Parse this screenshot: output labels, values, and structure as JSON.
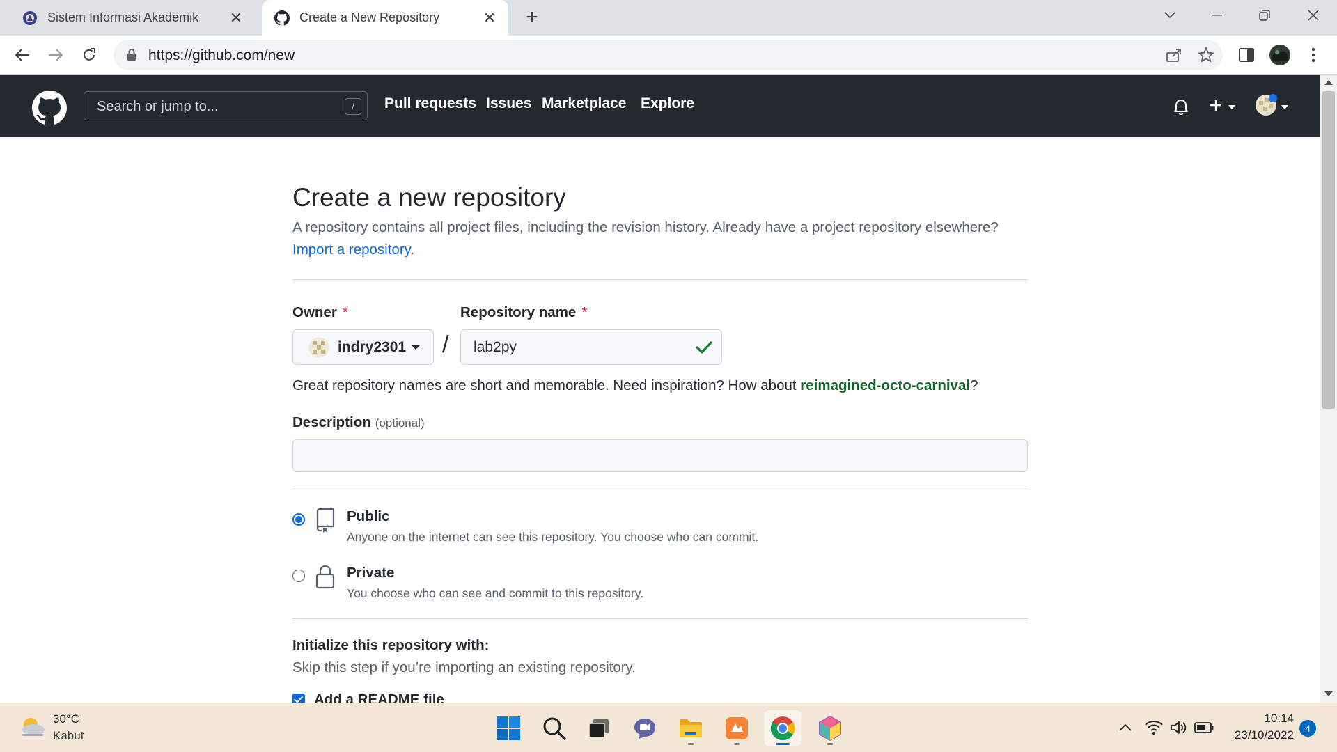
{
  "browser": {
    "tabs": [
      {
        "title": "Sistem Informasi Akademik",
        "active": false
      },
      {
        "title": "Create a New Repository",
        "active": true
      }
    ],
    "url": "https://github.com/new"
  },
  "github_header": {
    "search_placeholder": "Search or jump to...",
    "search_shortcut": "/",
    "nav": [
      "Pull requests",
      "Issues",
      "Marketplace",
      "Explore"
    ]
  },
  "form": {
    "title": "Create a new repository",
    "subtitle": "A repository contains all project files, including the revision history. Already have a project repository elsewhere?",
    "import_link": "Import a repository.",
    "owner_label": "Owner",
    "owner_value": "indry2301",
    "required_marker": "*",
    "slash": "/",
    "repo_label": "Repository name",
    "repo_value": "lab2py",
    "hint_prefix": "Great repository names are short and memorable. Need inspiration? How about ",
    "hint_suggestion": "reimagined-octo-carnival",
    "hint_suffix": "?",
    "description_label": "Description",
    "description_optional": "(optional)",
    "description_value": "",
    "visibility": {
      "selected": "public",
      "public_title": "Public",
      "public_desc": "Anyone on the internet can see this repository. You choose who can commit.",
      "private_title": "Private",
      "private_desc": "You choose who can see and commit to this repository."
    },
    "init_title": "Initialize this repository with:",
    "init_subtitle": "Skip this step if you’re importing an existing repository.",
    "readme_label": "Add a README file",
    "readme_checked": true
  },
  "taskbar": {
    "temperature": "30°C",
    "weather": "Kabut",
    "time": "10:14",
    "date": "23/10/2022",
    "notifications": "4",
    "apps": [
      "start-icon",
      "search-icon",
      "task-view-icon",
      "chat-icon",
      "file-explorer-icon",
      "sublime-like-app-icon",
      "chrome-icon",
      "dev-app-icon"
    ]
  },
  "colors": {
    "github_header_bg": "#24292f",
    "link_blue": "#0969da",
    "suggestion_green": "#116329",
    "required_red": "#cf222e",
    "taskbar_bg": "#f3e7d8"
  }
}
